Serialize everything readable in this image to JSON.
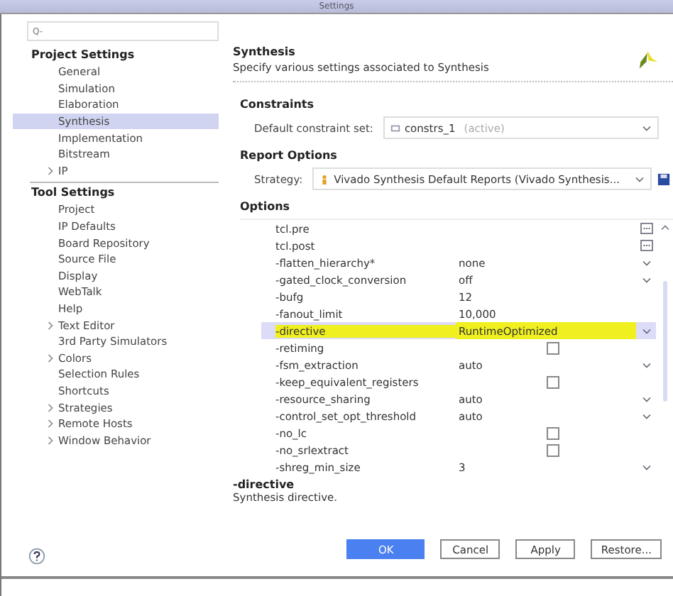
{
  "window": {
    "title": "Settings"
  },
  "sidebar": {
    "search": {
      "placeholder": "Q-"
    },
    "groups": [
      {
        "title": "Project Settings",
        "items": [
          {
            "label": "General",
            "selected": false,
            "expandable": false
          },
          {
            "label": "Simulation",
            "selected": false,
            "expandable": false
          },
          {
            "label": "Elaboration",
            "selected": false,
            "expandable": false
          },
          {
            "label": "Synthesis",
            "selected": true,
            "expandable": false
          },
          {
            "label": "Implementation",
            "selected": false,
            "expandable": false
          },
          {
            "label": "Bitstream",
            "selected": false,
            "expandable": false
          },
          {
            "label": "IP",
            "selected": false,
            "expandable": true
          }
        ]
      },
      {
        "title": "Tool Settings",
        "items": [
          {
            "label": "Project",
            "selected": false,
            "expandable": false
          },
          {
            "label": "IP Defaults",
            "selected": false,
            "expandable": false
          },
          {
            "label": "Board Repository",
            "selected": false,
            "expandable": false
          },
          {
            "label": "Source File",
            "selected": false,
            "expandable": false
          },
          {
            "label": "Display",
            "selected": false,
            "expandable": false
          },
          {
            "label": "WebTalk",
            "selected": false,
            "expandable": false
          },
          {
            "label": "Help",
            "selected": false,
            "expandable": false
          },
          {
            "label": "Text Editor",
            "selected": false,
            "expandable": true
          },
          {
            "label": "3rd Party Simulators",
            "selected": false,
            "expandable": false
          },
          {
            "label": "Colors",
            "selected": false,
            "expandable": true
          },
          {
            "label": "Selection Rules",
            "selected": false,
            "expandable": false
          },
          {
            "label": "Shortcuts",
            "selected": false,
            "expandable": false
          },
          {
            "label": "Strategies",
            "selected": false,
            "expandable": true
          },
          {
            "label": "Remote Hosts",
            "selected": false,
            "expandable": true
          },
          {
            "label": "Window Behavior",
            "selected": false,
            "expandable": true
          }
        ]
      }
    ]
  },
  "page": {
    "title": "Synthesis",
    "description": "Specify various settings associated to Synthesis"
  },
  "constraints": {
    "heading": "Constraints",
    "label": "Default constraint set:",
    "value": "constrs_1",
    "note": "(active)"
  },
  "report_options": {
    "heading": "Report Options",
    "label": "Strategy:",
    "value": "Vivado Synthesis Default Reports (Vivado Synthesis..."
  },
  "options": {
    "heading": "Options",
    "rows": [
      {
        "kind": "file",
        "name": "tcl.pre",
        "selected": false,
        "highlighted": false
      },
      {
        "kind": "file",
        "name": "tcl.post",
        "selected": false,
        "highlighted": false
      },
      {
        "kind": "dropdown",
        "name": "-flatten_hierarchy*",
        "value": "none",
        "selected": false,
        "highlighted": false
      },
      {
        "kind": "dropdown",
        "name": "-gated_clock_conversion",
        "value": "off",
        "selected": false,
        "highlighted": false
      },
      {
        "kind": "text",
        "name": "-bufg",
        "value": "12",
        "selected": false,
        "highlighted": false
      },
      {
        "kind": "text",
        "name": "-fanout_limit",
        "value": "10,000",
        "selected": false,
        "highlighted": false
      },
      {
        "kind": "dropdown",
        "name": "-directive",
        "value": "RuntimeOptimized",
        "selected": true,
        "highlighted": true
      },
      {
        "kind": "checkbox",
        "name": "-retiming",
        "checked": false,
        "selected": false,
        "highlighted": false
      },
      {
        "kind": "dropdown",
        "name": "-fsm_extraction",
        "value": "auto",
        "selected": false,
        "highlighted": false
      },
      {
        "kind": "checkbox",
        "name": "-keep_equivalent_registers",
        "checked": false,
        "selected": false,
        "highlighted": false
      },
      {
        "kind": "dropdown",
        "name": "-resource_sharing",
        "value": "auto",
        "selected": false,
        "highlighted": false
      },
      {
        "kind": "dropdown",
        "name": "-control_set_opt_threshold",
        "value": "auto",
        "selected": false,
        "highlighted": false
      },
      {
        "kind": "checkbox",
        "name": "-no_lc",
        "checked": false,
        "selected": false,
        "highlighted": false
      },
      {
        "kind": "checkbox",
        "name": "-no_srlextract",
        "checked": false,
        "selected": false,
        "highlighted": false
      },
      {
        "kind": "dropdown",
        "name": "-shreg_min_size",
        "value": "3",
        "selected": false,
        "highlighted": false
      }
    ]
  },
  "help": {
    "title": "-directive",
    "text": "Synthesis directive."
  },
  "buttons": [
    {
      "label": "OK",
      "primary": true
    },
    {
      "label": "Cancel",
      "primary": false
    },
    {
      "label": "Apply",
      "primary": false
    },
    {
      "label": "Restore...",
      "primary": false
    }
  ]
}
